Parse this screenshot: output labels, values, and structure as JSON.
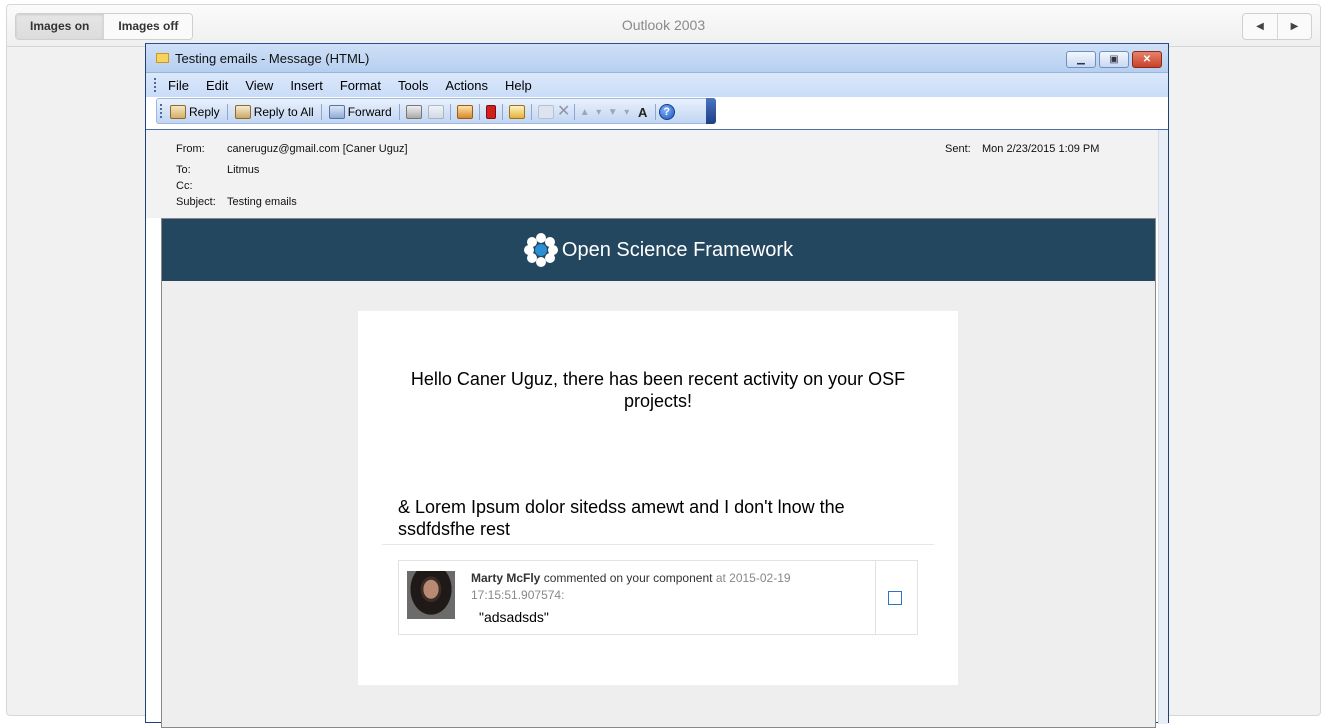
{
  "toolbar": {
    "images_on": "Images on",
    "images_off": "Images off",
    "title": "Outlook 2003",
    "prev_icon": "triangle-left",
    "next_icon": "triangle-right"
  },
  "window": {
    "title": "Testing emails - Message (HTML)"
  },
  "menu": {
    "items": [
      "File",
      "Edit",
      "View",
      "Insert",
      "Format",
      "Tools",
      "Actions",
      "Help"
    ]
  },
  "actions": {
    "reply": "Reply",
    "reply_all": "Reply to All",
    "forward": "Forward"
  },
  "header": {
    "from_label": "From:",
    "from_value": "caneruguz@gmail.com [Caner Uguz]",
    "to_label": "To:",
    "to_value": "Litmus",
    "cc_label": "Cc:",
    "cc_value": "",
    "subject_label": "Subject:",
    "subject_value": "Testing emails",
    "sent_label": "Sent:",
    "sent_value": "Mon 2/23/2015 1:09 PM"
  },
  "email": {
    "brand": "Open Science Framework",
    "greeting": "Hello Caner Uguz, there has been recent activity on your OSF projects!",
    "section_title": "& Lorem Ipsum dolor sitedss amewt and I don't lnow the ssdfdsfhe rest",
    "comment": {
      "author": "Marty McFly",
      "action": "commented on your component",
      "at": "at 2015-02-19",
      "timestamp": "17:15:51.907574:",
      "text": "\"adsadsds\""
    }
  },
  "colors": {
    "osf_bar": "#244760",
    "window_border": "#1f3f7a"
  }
}
